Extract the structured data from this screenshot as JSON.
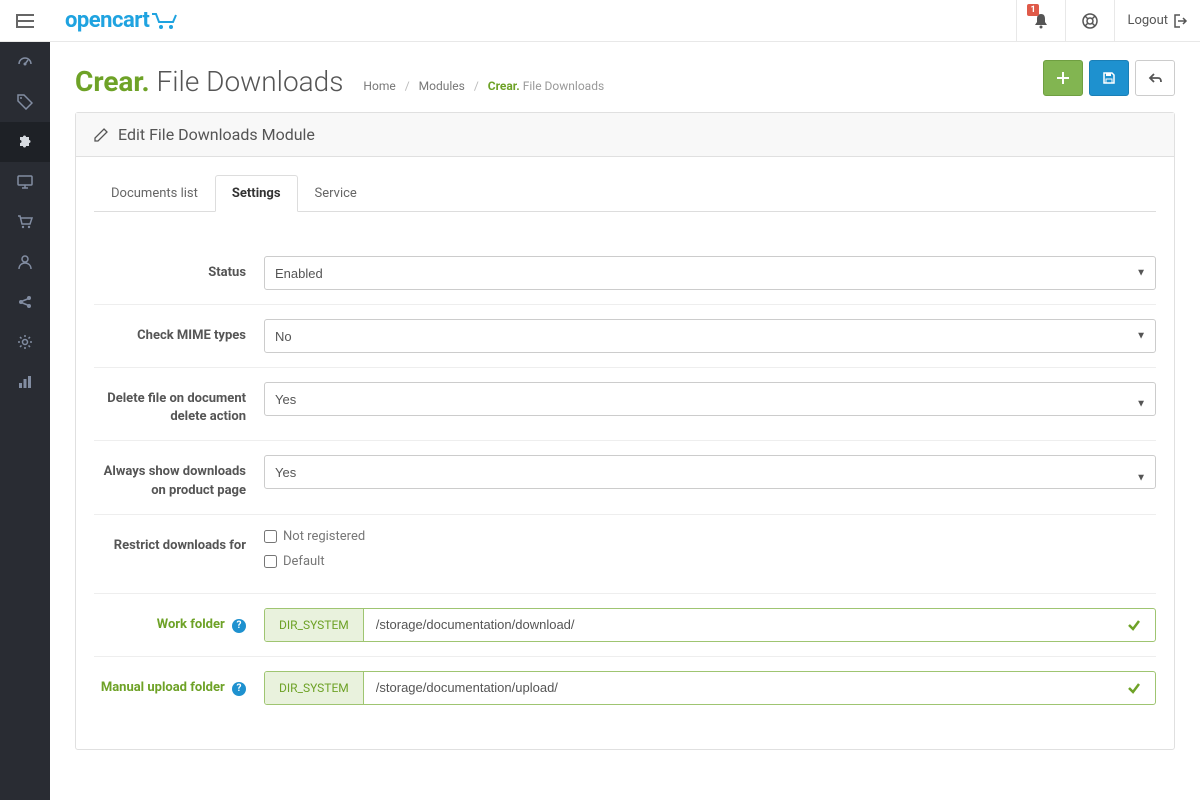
{
  "header": {
    "logo_text": "opencart",
    "notif_count": "1",
    "logout_label": "Logout"
  },
  "page": {
    "title_prefix": "Crear.",
    "title_suffix": "File Downloads",
    "breadcrumb": {
      "home": "Home",
      "modules": "Modules",
      "current_prefix": "Crear.",
      "current_suffix": "File Downloads"
    }
  },
  "panel": {
    "heading": "Edit File Downloads Module"
  },
  "tabs": {
    "documents": "Documents list",
    "settings": "Settings",
    "service": "Service"
  },
  "form": {
    "status": {
      "label": "Status",
      "value": "Enabled"
    },
    "mime": {
      "label": "Check MIME types",
      "value": "No"
    },
    "delete": {
      "label": "Delete file on document delete action",
      "value": "Yes"
    },
    "always_show": {
      "label": "Always show downloads on product page",
      "value": "Yes"
    },
    "restrict": {
      "label": "Restrict downloads for",
      "opt1": "Not registered",
      "opt2": "Default"
    },
    "work_folder": {
      "label": "Work folder",
      "prefix": "DIR_SYSTEM",
      "value": "/storage/documentation/download/"
    },
    "upload_folder": {
      "label": "Manual upload folder",
      "prefix": "DIR_SYSTEM",
      "value": "/storage/documentation/upload/"
    }
  }
}
